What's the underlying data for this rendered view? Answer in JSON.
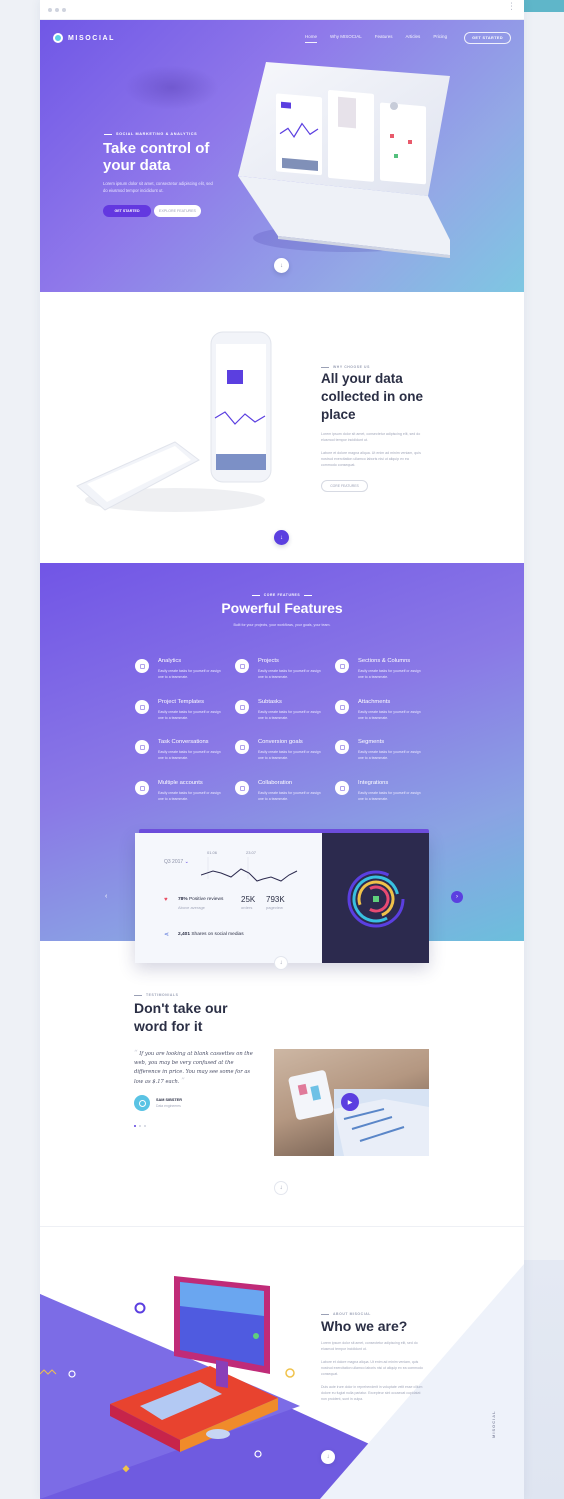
{
  "app": {
    "brand": "MISOCIAL",
    "side_brand": "MISOCIAL",
    "browser_menu": "⋮"
  },
  "nav": {
    "items": [
      "Home",
      "Why MISOCIAL",
      "Features",
      "Articles",
      "Pricing"
    ],
    "cta": "GET STARTED"
  },
  "hero": {
    "eyebrow": "SOCIAL MARKETING & ANALYTICS",
    "title": "Take control of your data",
    "text": "Lorem ipsum dolor sit amet, consectetur adipiscing elit, sed do eiusmod tempor incididunt ut.",
    "primary_button": "GET STARTED",
    "secondary_button": "EXPLORE FEATURES",
    "scroll_icon": "arrow-down-icon"
  },
  "why": {
    "eyebrow": "WHY CHOOSE US",
    "title": "All your data collected in one place",
    "p1": "Lorem ipsum dolor sit amet, consectetur adipiscing elit, sed do eiusmod tempor incididunt ut.",
    "p2": "Labore et dolore magna aliqua. Ut enim ad minim veniam, quis nostrud exercitation ullamco laboris nisi ut aliquip ex ea commodo consequat.",
    "button": "CORE FEATURES"
  },
  "features": {
    "eyebrow": "CORE FEATURES",
    "title": "Powerful Features",
    "subtitle": "Built for your projects, your workflows, your goals, your team.",
    "items": [
      {
        "title": "Analytics",
        "text": "Easily create tasks for yourself or assign one to a teammate."
      },
      {
        "title": "Projects",
        "text": "Easily create tasks for yourself or assign one to a teammate."
      },
      {
        "title": "Sections & Columns",
        "text": "Easily create tasks for yourself or assign one to a teammate."
      },
      {
        "title": "Project Templates",
        "text": "Easily create tasks for yourself or assign one to a teammate."
      },
      {
        "title": "Subtasks",
        "text": "Easily create tasks for yourself or assign one to a teammate."
      },
      {
        "title": "Attachments",
        "text": "Easily create tasks for yourself or assign one to a teammate."
      },
      {
        "title": "Task Conversations",
        "text": "Easily create tasks for yourself or assign one to a teammate."
      },
      {
        "title": "Conversion goals",
        "text": "Easily create tasks for yourself or assign one to a teammate."
      },
      {
        "title": "Segments",
        "text": "Easily create tasks for yourself or assign one to a teammate."
      },
      {
        "title": "Multiple accounts",
        "text": "Easily create tasks for yourself or assign one to a teammate."
      },
      {
        "title": "Collaboration",
        "text": "Easily create tasks for yourself or assign one to a teammate."
      },
      {
        "title": "Integrations",
        "text": "Easily create tasks for yourself or assign one to a teammate."
      }
    ]
  },
  "dashboard": {
    "period": "Q3 2017",
    "date1": "01.06",
    "date2": "23.07",
    "positive_pct": "78%",
    "positive_label": "Positive reviews",
    "positive_sub": "Above average",
    "orders_value": "25K",
    "orders_label": "orders",
    "pageviews_value": "793K",
    "pageviews_label": "pageview",
    "shares": "2,401",
    "shares_label": "Shares on social medias"
  },
  "testimonials": {
    "eyebrow": "TESTIMONIALS",
    "title": "Don't take our word for it",
    "quote": "If you are looking at blank cassettes on the web, you may be very confused at the difference in price. You may see some for as low as $.17 each.",
    "author": "SAM SIBSTER",
    "role": "Data engineeres"
  },
  "about": {
    "eyebrow": "ABOUT MISOCIAL",
    "title": "Who we are?",
    "p1": "Lorem ipsum dolor sit amet, consectetur adipiscing elit, sed do eiusmod tempor incididunt ut.",
    "p2": "Labore et dolore magna aliqua. Ut enim ad minim veniam, quis nostrud exercitation ullamco laboris nisi ut aliquip ex ea commodo consequat.",
    "p3": "Duis aute irure dolor in reprehenderit in voluptate velit esse cillum dolore eu fugiat nulla pariatur. Excepteur sint occaecat cupidatat non proident, sunt in culpa."
  },
  "colors": {
    "primary": "#5b3fe0",
    "accent": "#5fd0e6",
    "dark": "#2c2a4e"
  }
}
